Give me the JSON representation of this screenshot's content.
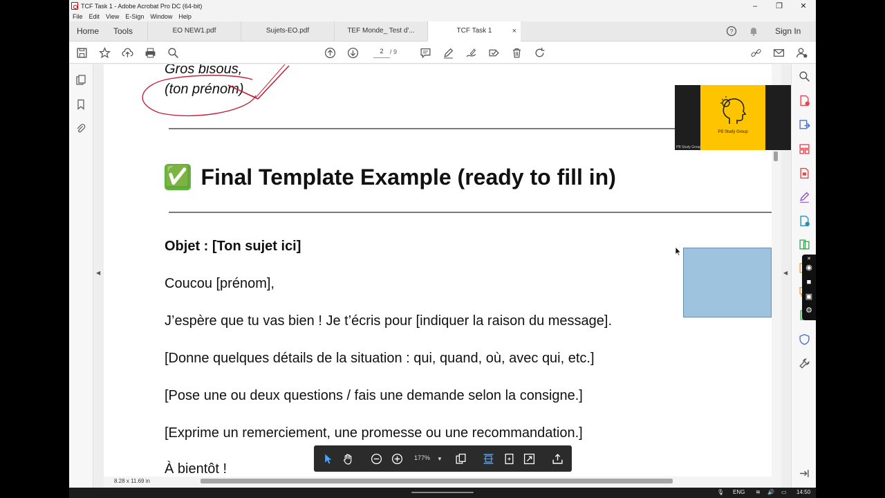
{
  "window": {
    "title": "TCF Task 1 - Adobe Acrobat Pro DC (64-bit)"
  },
  "menu": [
    "File",
    "Edit",
    "View",
    "E-Sign",
    "Window",
    "Help"
  ],
  "nav": {
    "home": "Home",
    "tools": "Tools"
  },
  "tabs": [
    {
      "label": "EO NEW1.pdf"
    },
    {
      "label": "Sujets-EO.pdf"
    },
    {
      "label": "TEF Monde_ Test d'..."
    },
    {
      "label": "TCF Task 1",
      "close": "×"
    }
  ],
  "header_right": {
    "sign_in": "Sign In"
  },
  "toolbar": {
    "page_current": "2",
    "page_total": "/ 9"
  },
  "document": {
    "closing_line1": "Gros bisous,",
    "closing_line2": "(ton prénom)",
    "heading_emoji": "✅",
    "heading": "Final Template Example (ready to fill in)",
    "objet": "Objet : [Ton sujet ici]",
    "greeting": "Coucou [prénom],",
    "para1": "J’espère que tu vas bien ! Je t’écris pour [indiquer la raison du message].",
    "para2": "[Donne quelques détails de la situation : qui, quand, où, avec qui, etc.]",
    "para3": "[Pose une ou deux questions / fais une demande selon la consigne.]",
    "para4": "[Exprime un remerciement, une promesse ou une recommandation.]",
    "signoff": "À bientôt !"
  },
  "status": {
    "page_size": "8.28 x 11.69 in"
  },
  "floating_toolbar": {
    "zoom": "177%"
  },
  "webcam": {
    "brand": "PB Study Group",
    "label": "PB Study Group"
  },
  "taskbar": {
    "lang": "ENG",
    "time": "14:50"
  },
  "colors": {
    "accent_blue": "#1473e6",
    "annotation_red": "#c8213a",
    "webcam_yellow": "#ffc400",
    "overlay_blue": "#9dc3de"
  }
}
